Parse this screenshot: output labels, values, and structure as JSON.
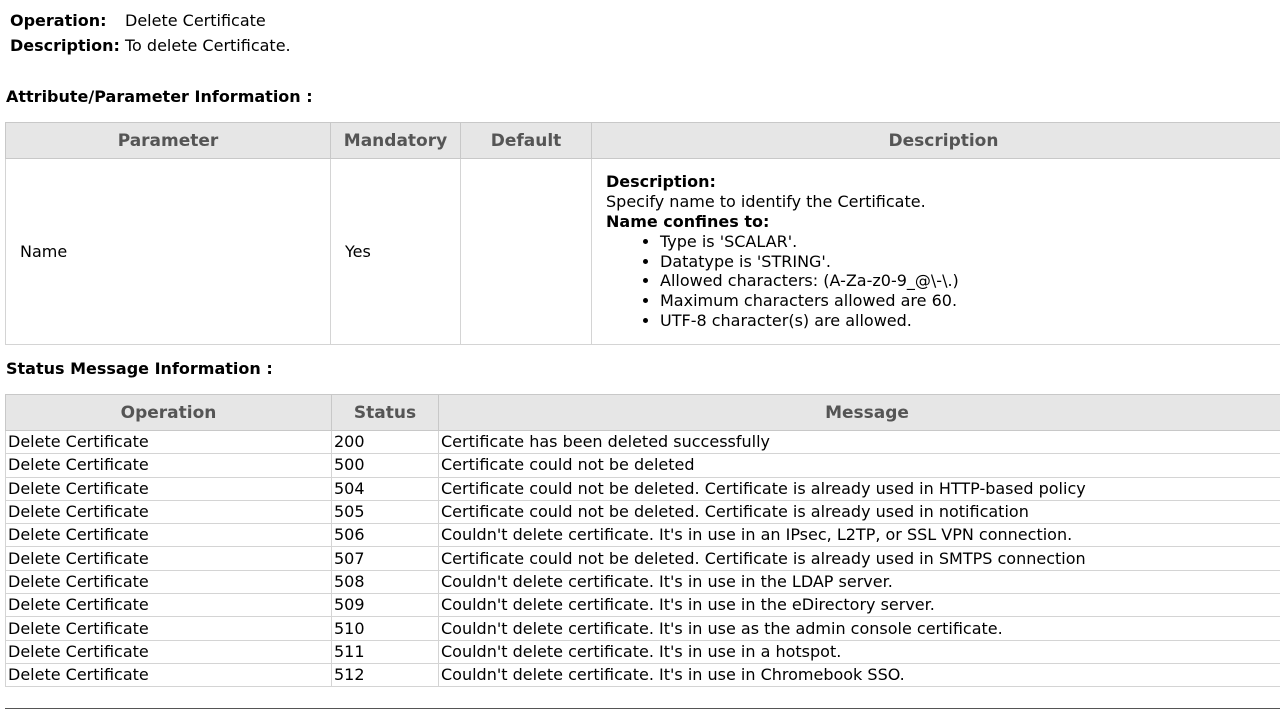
{
  "info": {
    "operation_label": "Operation:",
    "operation_value": "Delete Certificate",
    "description_label": "Description:",
    "description_value": "To delete Certificate."
  },
  "attribute_section": {
    "title": "Attribute/Parameter Information :",
    "headers": [
      "Parameter",
      "Mandatory",
      "Default",
      "Description"
    ],
    "row": {
      "parameter": "Name",
      "mandatory": "Yes",
      "default": "",
      "description_heading": "Description:",
      "description_text": "Specify name to identify the Certificate.",
      "confines_heading": "Name confines to:",
      "confines": [
        "Type is 'SCALAR'.",
        "Datatype is 'STRING'.",
        "Allowed characters: (A-Za-z0-9_@\\-\\.)",
        "Maximum characters allowed are 60.",
        "UTF-8 character(s) are allowed."
      ]
    }
  },
  "status_section": {
    "title": "Status Message Information :",
    "headers": [
      "Operation",
      "Status",
      "Message"
    ],
    "rows": [
      {
        "operation": "Delete Certificate",
        "status": "200",
        "message": "Certificate has been deleted successfully"
      },
      {
        "operation": "Delete Certificate",
        "status": "500",
        "message": "Certificate could not be deleted"
      },
      {
        "operation": "Delete Certificate",
        "status": "504",
        "message": "Certificate could not be deleted. Certificate is already used in HTTP-based policy"
      },
      {
        "operation": "Delete Certificate",
        "status": "505",
        "message": "Certificate could not be deleted. Certificate is already used in notification"
      },
      {
        "operation": "Delete Certificate",
        "status": "506",
        "message": "Couldn't delete certificate. It's in use in an IPsec, L2TP, or SSL VPN connection."
      },
      {
        "operation": "Delete Certificate",
        "status": "507",
        "message": "Certificate could not be deleted. Certificate is already used in SMTPS connection"
      },
      {
        "operation": "Delete Certificate",
        "status": "508",
        "message": "Couldn't delete certificate. It's in use in the LDAP server."
      },
      {
        "operation": "Delete Certificate",
        "status": "509",
        "message": "Couldn't delete certificate. It's in use in the eDirectory server."
      },
      {
        "operation": "Delete Certificate",
        "status": "510",
        "message": "Couldn't delete certificate. It's in use as the admin console certificate."
      },
      {
        "operation": "Delete Certificate",
        "status": "511",
        "message": "Couldn't delete certificate. It's in use in a hotspot."
      },
      {
        "operation": "Delete Certificate",
        "status": "512",
        "message": "Couldn't delete certificate. It's in use in Chromebook SSO."
      }
    ]
  }
}
